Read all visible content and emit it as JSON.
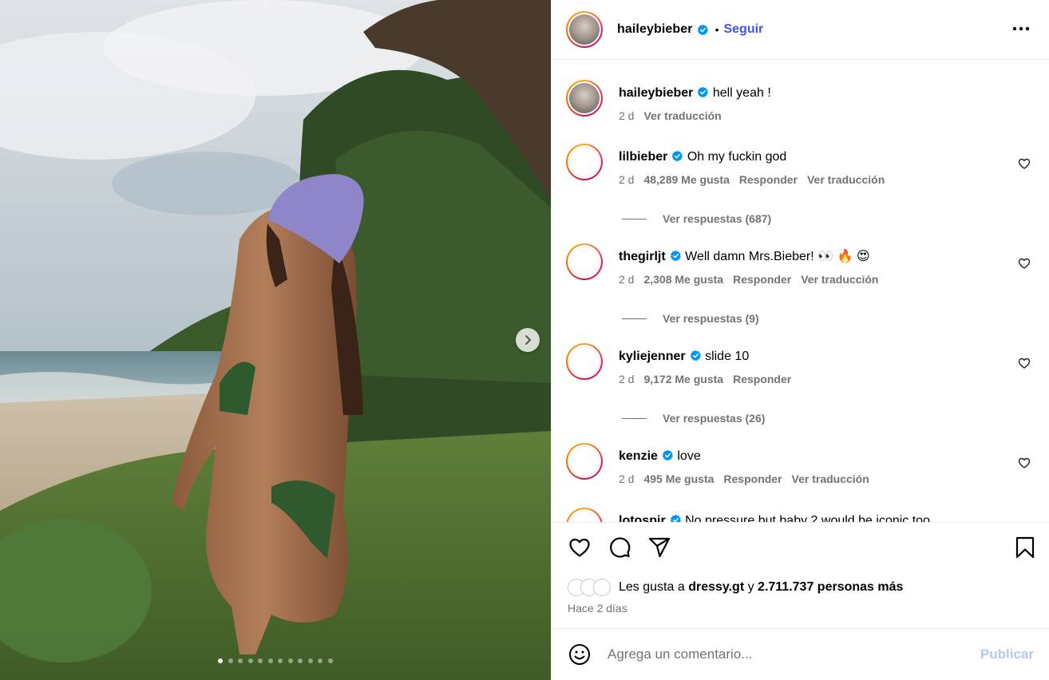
{
  "post": {
    "author": "haileybieber",
    "follow_label": "Seguir",
    "separator": "•",
    "carousel": {
      "slide_count": 12,
      "active_index": 0
    }
  },
  "comments": [
    {
      "user": "haileybieber",
      "text": "hell yeah !",
      "time": "2 d",
      "likes": "",
      "reply_label": "",
      "translate_label": "Ver traducción",
      "replies_label": ""
    },
    {
      "user": "lilbieber",
      "text": "Oh my fuckin god",
      "time": "2 d",
      "likes": "48,289 Me gusta",
      "reply_label": "Responder",
      "translate_label": "Ver traducción",
      "replies_label": "Ver respuestas (687)"
    },
    {
      "user": "thegirljt",
      "text": "Well damn Mrs.Bieber! 👀 🔥 😍",
      "time": "2 d",
      "likes": "2,308 Me gusta",
      "reply_label": "Responder",
      "translate_label": "Ver traducción",
      "replies_label": "Ver respuestas (9)"
    },
    {
      "user": "kyliejenner",
      "text": "slide 10",
      "time": "2 d",
      "likes": "9,172 Me gusta",
      "reply_label": "Responder",
      "translate_label": "",
      "replies_label": "Ver respuestas (26)"
    },
    {
      "user": "kenzie",
      "text": "love",
      "time": "2 d",
      "likes": "495 Me gusta",
      "reply_label": "Responder",
      "translate_label": "Ver traducción",
      "replies_label": ""
    },
    {
      "user": "lotospir",
      "text": "No pressure but baby 2 would be iconic too",
      "time": "",
      "likes": "",
      "reply_label": "",
      "translate_label": "",
      "replies_label": ""
    }
  ],
  "likes": {
    "prefix": "Les gusta a",
    "first_user": "dressy.gt",
    "conjunction": "y",
    "others": "2.711.737 personas más",
    "posted": "Hace 2 días"
  },
  "composer": {
    "placeholder": "Agrega un comentario...",
    "publish_label": "Publicar"
  },
  "colors": {
    "accent": "#4152f5",
    "verified": "#0095f6",
    "muted": "#737373",
    "publish_disabled": "#b3c8f2"
  }
}
